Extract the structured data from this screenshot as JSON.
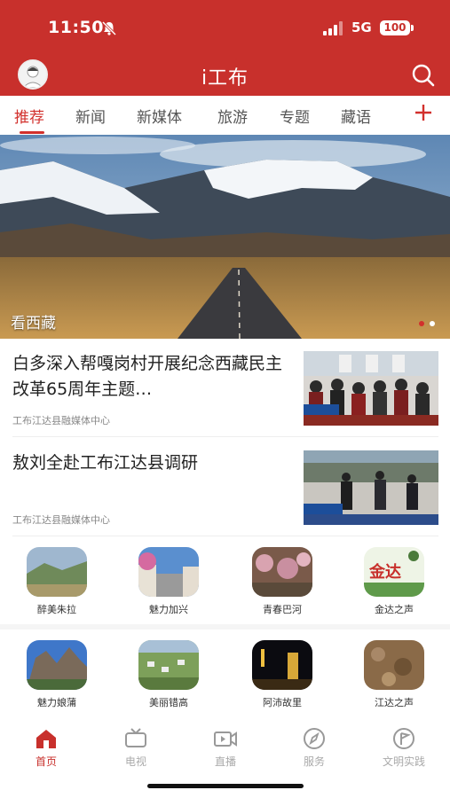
{
  "status_bar": {
    "time": "11:50",
    "network": "5G",
    "battery": "100"
  },
  "header": {
    "title": "i工布",
    "avatar_icon": "user-avatar",
    "search_icon": "search-icon",
    "color": "#c8302c"
  },
  "tabs": [
    {
      "label": "推荐",
      "active": true
    },
    {
      "label": "新闻",
      "active": false
    },
    {
      "label": "新媒体",
      "active": false
    },
    {
      "label": "旅游",
      "active": false
    },
    {
      "label": "专题",
      "active": false
    },
    {
      "label": "藏语",
      "active": false
    }
  ],
  "tab_add_icon": "plus-icon",
  "banner": {
    "caption": "看西藏",
    "slide_count": 2,
    "active_slide": 1
  },
  "news": [
    {
      "title": "白多深入帮嘎岗村开展纪念西藏民主改革65周年主题…",
      "source": "工布江达县融媒体中心"
    },
    {
      "title": "敖刘全赴工布江达县调研",
      "source": "工布江达县融媒体中心"
    }
  ],
  "shortcuts_row1": [
    {
      "label": "醉美朱拉"
    },
    {
      "label": "魅力加兴"
    },
    {
      "label": "青春巴河"
    },
    {
      "label": "金达之声",
      "thumb_text": "金达"
    }
  ],
  "shortcuts_row2": [
    {
      "label": "魅力娘蒲"
    },
    {
      "label": "美丽错高"
    },
    {
      "label": "阿沛故里"
    },
    {
      "label": "江达之声"
    }
  ],
  "bottom_nav": [
    {
      "label": "首页",
      "icon": "home-icon",
      "active": true
    },
    {
      "label": "电视",
      "icon": "tv-icon",
      "active": false
    },
    {
      "label": "直播",
      "icon": "live-video-icon",
      "active": false
    },
    {
      "label": "服务",
      "icon": "compass-icon",
      "active": false
    },
    {
      "label": "文明实践",
      "icon": "flag-icon",
      "active": false
    }
  ]
}
